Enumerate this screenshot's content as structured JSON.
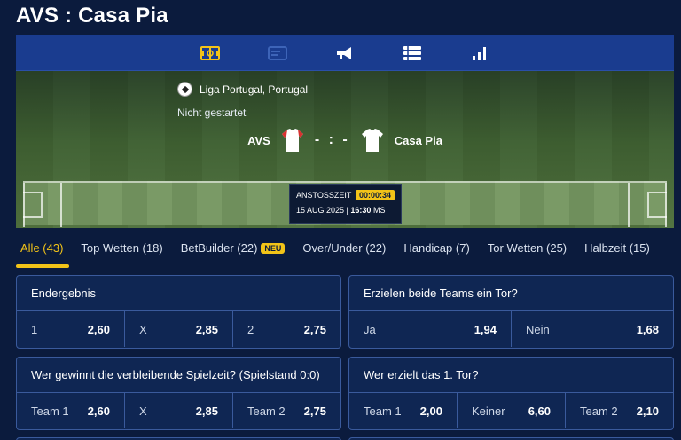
{
  "page": {
    "title": "AVS : Casa Pia"
  },
  "icon_nav": [
    {
      "name": "field-icon",
      "active": true
    },
    {
      "name": "stats-card-icon",
      "active": false
    },
    {
      "name": "megaphone-icon",
      "active": false
    },
    {
      "name": "list-icon",
      "active": false
    },
    {
      "name": "bar-chart-icon",
      "active": false
    }
  ],
  "match": {
    "league": "Liga Portugal, Portugal",
    "status": "Nicht gestartet",
    "home_team": "AVS",
    "away_team": "Casa Pia",
    "score": "- : -",
    "kickoff_label": "ANSTOSSZEIT",
    "countdown": "00:00:34",
    "date": "15 AUG 2025 |",
    "time": "16:30",
    "tz": "MS"
  },
  "tabs": [
    {
      "label": "Alle (43)",
      "active": true
    },
    {
      "label": "Top Wetten (18)"
    },
    {
      "label": "BetBuilder (22)",
      "badge": "NEU"
    },
    {
      "label": "Over/Under (22)"
    },
    {
      "label": "Handicap (7)"
    },
    {
      "label": "Tor Wetten (25)"
    },
    {
      "label": "Halbzeit (15)"
    }
  ],
  "markets": [
    {
      "title": "Endergebnis",
      "odds": [
        {
          "label": "1",
          "value": "2,60"
        },
        {
          "label": "X",
          "value": "2,85"
        },
        {
          "label": "2",
          "value": "2,75"
        }
      ]
    },
    {
      "title": "Erzielen beide Teams ein Tor?",
      "odds": [
        {
          "label": "Ja",
          "value": "1,94"
        },
        {
          "label": "Nein",
          "value": "1,68"
        }
      ]
    },
    {
      "title": "Wer gewinnt die verbleibende Spielzeit? (Spielstand 0:0)",
      "odds": [
        {
          "label": "Team 1",
          "value": "2,60"
        },
        {
          "label": "X",
          "value": "2,85"
        },
        {
          "label": "Team 2",
          "value": "2,75"
        }
      ]
    },
    {
      "title": "Wer erzielt das 1. Tor?",
      "odds": [
        {
          "label": "Team 1",
          "value": "2,00"
        },
        {
          "label": "Keiner",
          "value": "6,60"
        },
        {
          "label": "Team 2",
          "value": "2,10"
        }
      ]
    }
  ],
  "colors": {
    "accent": "#f2c318",
    "nav": "#1a3c8f",
    "background": "#0b1b3d",
    "card": "#0f2653"
  }
}
